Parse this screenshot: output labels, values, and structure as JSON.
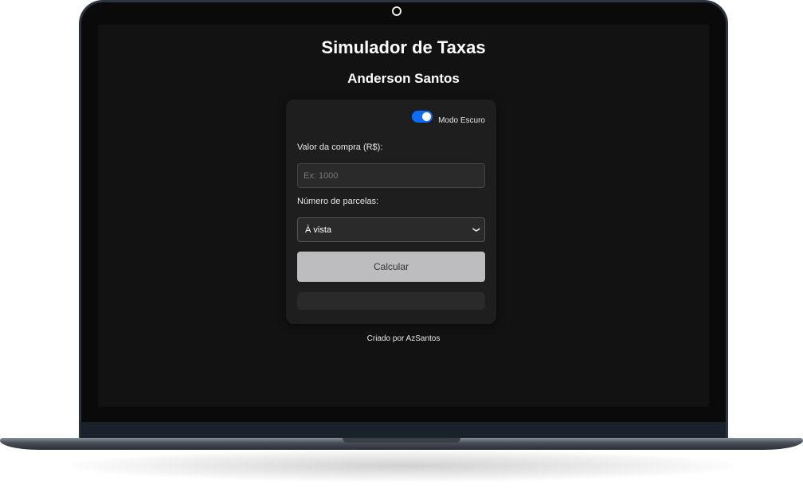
{
  "app": {
    "title": "Simulador de Taxas",
    "subtitle": "Anderson Santos"
  },
  "theme_toggle": {
    "label": "Modo Escuro",
    "on": true,
    "color": "#0d6efd"
  },
  "form": {
    "valor_label": "Valor da compra (R$):",
    "valor_value": "",
    "valor_placeholder": "Ex: 1000",
    "parcelas_label": "Número de parcelas:",
    "parcelas_selected": "À vista",
    "calculate_label": "Calcular"
  },
  "result": {
    "text": ""
  },
  "footer": {
    "text": "Criado por AzSantos"
  },
  "icons": {
    "select_chevron": "chevron-down-icon",
    "camera": "camera-icon"
  }
}
